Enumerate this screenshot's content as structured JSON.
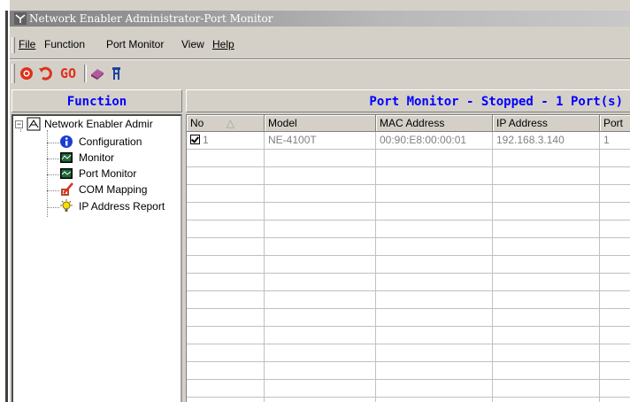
{
  "window": {
    "title": "Network Enabler Administrator-Port Monitor"
  },
  "menu": {
    "items": [
      {
        "label": "File"
      },
      {
        "label": "Function"
      },
      {
        "label": "Port Monitor"
      },
      {
        "label": "View"
      },
      {
        "label": "Help"
      }
    ]
  },
  "toolbar": {
    "buttons": [
      {
        "icon": "refresh-stop-icon"
      },
      {
        "icon": "undo-arrow-icon"
      },
      {
        "icon": "go-icon",
        "label": "GO"
      },
      {
        "icon": "settings-book-icon"
      },
      {
        "icon": "exit-door-icon"
      }
    ]
  },
  "function_panel": {
    "header": "Function",
    "tree": {
      "root": "Network Enabler Admir",
      "children": [
        {
          "label": "Configuration",
          "icon": "info-icon"
        },
        {
          "label": "Monitor",
          "icon": "monitor-icon"
        },
        {
          "label": "Port Monitor",
          "icon": "port-monitor-icon"
        },
        {
          "label": "COM Mapping",
          "icon": "com-mapping-icon"
        },
        {
          "label": "IP Address Report",
          "icon": "lightbulb-icon"
        }
      ]
    }
  },
  "port_monitor": {
    "header": "Port Monitor - Stopped - 1 Port(s)",
    "columns": [
      "No",
      "Model",
      "MAC Address",
      "IP Address",
      "Port"
    ],
    "rows": [
      {
        "no": "1",
        "checked": true,
        "model": "NE-4100T",
        "mac": "00:90:E8:00:00:01",
        "ip": "192.168.3.140",
        "port": "1"
      }
    ]
  }
}
